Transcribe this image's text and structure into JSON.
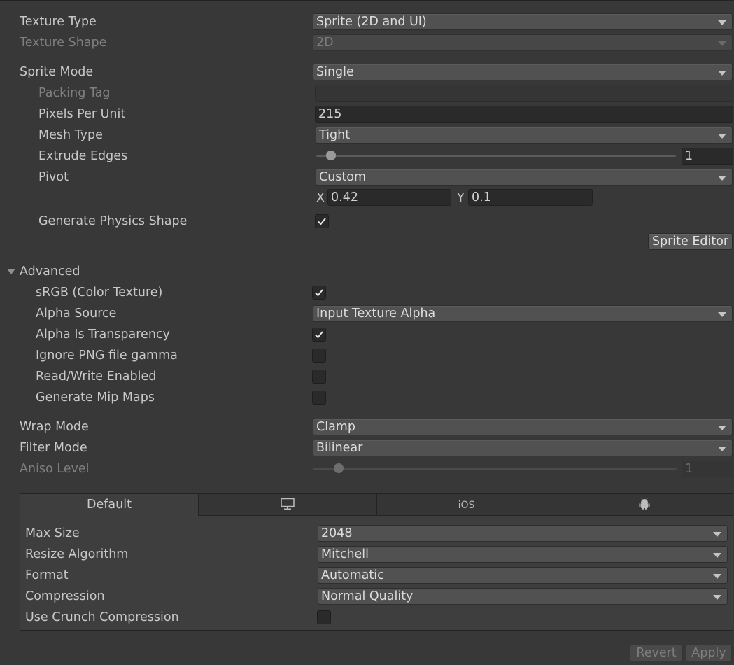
{
  "texture_type": {
    "label": "Texture Type",
    "value": "Sprite (2D and UI)"
  },
  "texture_shape": {
    "label": "Texture Shape",
    "value": "2D"
  },
  "sprite_mode": {
    "label": "Sprite Mode",
    "value": "Single"
  },
  "packing_tag": {
    "label": "Packing Tag",
    "value": ""
  },
  "pixels_per_unit": {
    "label": "Pixels Per Unit",
    "value": "215"
  },
  "mesh_type": {
    "label": "Mesh Type",
    "value": "Tight"
  },
  "extrude_edges": {
    "label": "Extrude Edges",
    "value": "1",
    "slider_fraction": 0.02
  },
  "pivot": {
    "label": "Pivot",
    "value": "Custom",
    "x_label": "X",
    "x_value": "0.42",
    "y_label": "Y",
    "y_value": "0.1"
  },
  "generate_physics_shape": {
    "label": "Generate Physics Shape",
    "checked": true
  },
  "sprite_editor_button": "Sprite Editor",
  "advanced": {
    "label": "Advanced",
    "srgb": {
      "label": "sRGB (Color Texture)",
      "checked": true
    },
    "alpha_source": {
      "label": "Alpha Source",
      "value": "Input Texture Alpha"
    },
    "alpha_is_transparency": {
      "label": "Alpha Is Transparency",
      "checked": true
    },
    "ignore_png_gamma": {
      "label": "Ignore PNG file gamma",
      "checked": false
    },
    "read_write": {
      "label": "Read/Write Enabled",
      "checked": false
    },
    "generate_mip_maps": {
      "label": "Generate Mip Maps",
      "checked": false
    }
  },
  "wrap_mode": {
    "label": "Wrap Mode",
    "value": "Clamp"
  },
  "filter_mode": {
    "label": "Filter Mode",
    "value": "Bilinear"
  },
  "aniso_level": {
    "label": "Aniso Level",
    "value": "1",
    "slider_fraction": 0.075
  },
  "platform_tabs": [
    {
      "label": "Default",
      "icon": "text"
    },
    {
      "label": "",
      "icon": "monitor-icon"
    },
    {
      "label": "iOS",
      "icon": "text"
    },
    {
      "label": "",
      "icon": "android-icon"
    }
  ],
  "platform": {
    "max_size": {
      "label": "Max Size",
      "value": "2048"
    },
    "resize_algorithm": {
      "label": "Resize Algorithm",
      "value": "Mitchell"
    },
    "format": {
      "label": "Format",
      "value": "Automatic"
    },
    "compression": {
      "label": "Compression",
      "value": "Normal Quality"
    },
    "use_crunch": {
      "label": "Use Crunch Compression",
      "checked": false
    }
  },
  "revert_button": "Revert",
  "apply_button": "Apply"
}
